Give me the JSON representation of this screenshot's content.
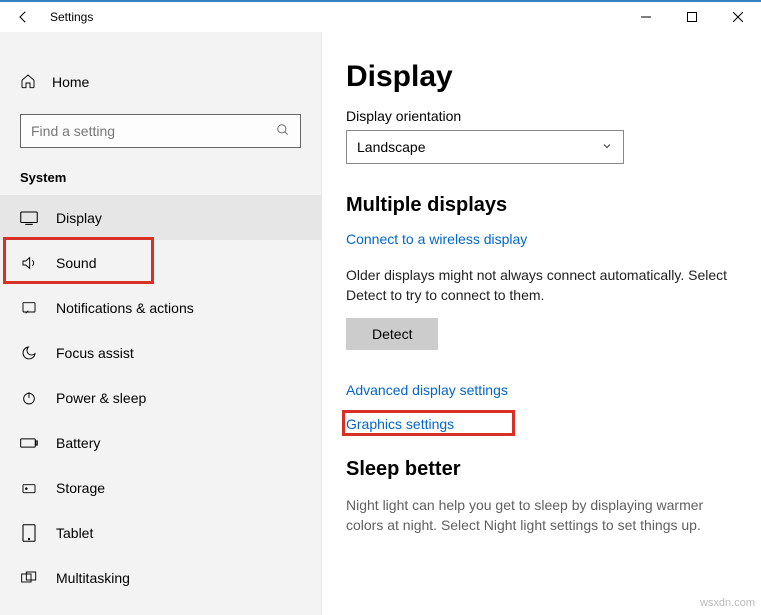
{
  "window": {
    "title": "Settings"
  },
  "sidebar": {
    "home": "Home",
    "search_placeholder": "Find a setting",
    "section": "System",
    "items": [
      {
        "label": "Display"
      },
      {
        "label": "Sound"
      },
      {
        "label": "Notifications & actions"
      },
      {
        "label": "Focus assist"
      },
      {
        "label": "Power & sleep"
      },
      {
        "label": "Battery"
      },
      {
        "label": "Storage"
      },
      {
        "label": "Tablet"
      },
      {
        "label": "Multitasking"
      }
    ]
  },
  "main": {
    "title": "Display",
    "orientation_label": "Display orientation",
    "orientation_value": "Landscape",
    "multiple_heading": "Multiple displays",
    "wireless_link": "Connect to a wireless display",
    "older_desc": "Older displays might not always connect automatically. Select Detect to try to connect to them.",
    "detect_btn": "Detect",
    "advanced_link": "Advanced display settings",
    "graphics_link": "Graphics settings",
    "sleep_heading": "Sleep better",
    "sleep_desc": "Night light can help you get to sleep by displaying warmer colors at night. Select Night light settings to set things up."
  },
  "watermark": "wsxdn.com"
}
